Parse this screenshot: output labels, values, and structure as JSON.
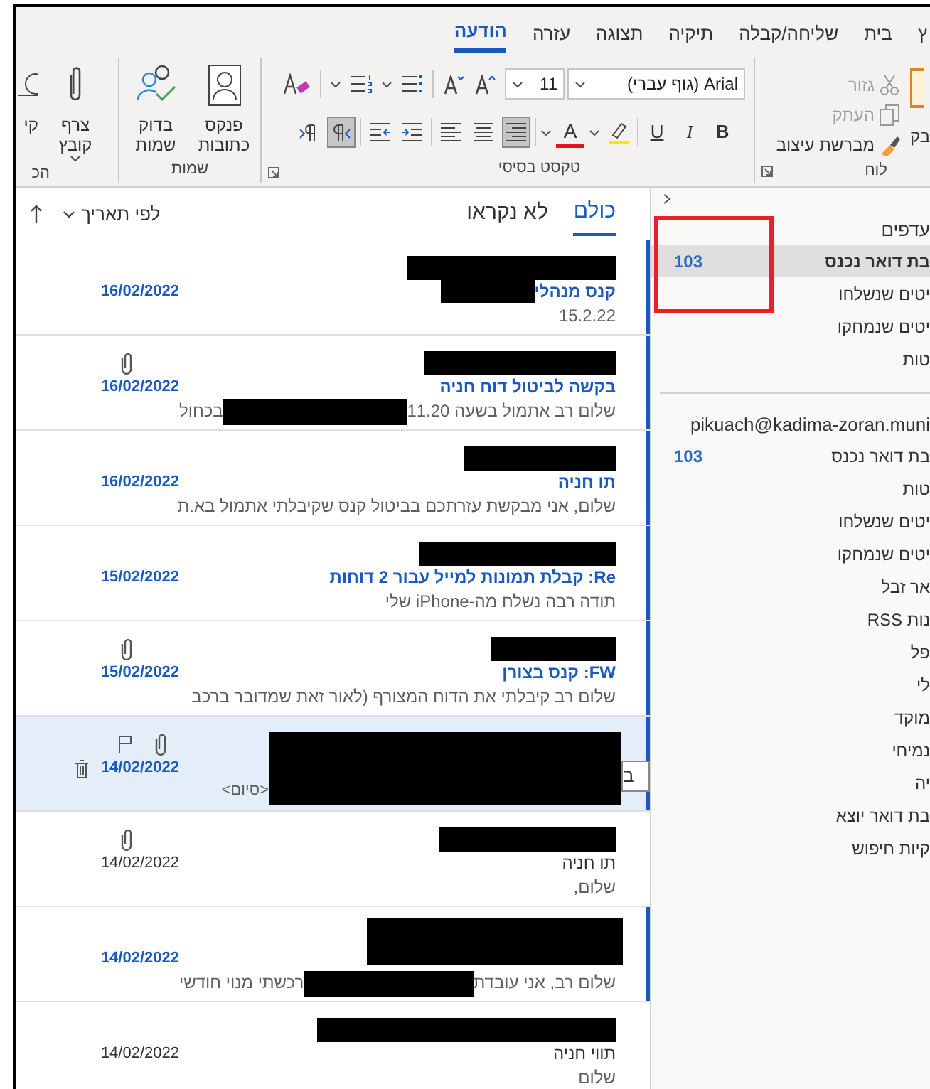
{
  "ribbon": {
    "tabs": [
      {
        "label": "ץ",
        "selected": false
      },
      {
        "label": "בית",
        "selected": false
      },
      {
        "label": "שליחה/קבלה",
        "selected": false
      },
      {
        "label": "תיקיה",
        "selected": false
      },
      {
        "label": "תצוגה",
        "selected": false
      },
      {
        "label": "עזרה",
        "selected": false
      },
      {
        "label": "הודעה",
        "selected": true
      }
    ],
    "clipboard": {
      "label": "לוח",
      "paste": "בק",
      "items": [
        {
          "kind": "cut",
          "label": "גזור",
          "disabled": true
        },
        {
          "kind": "copy",
          "label": "העתק",
          "disabled": true
        },
        {
          "kind": "painter",
          "label": "מברשת עיצוב",
          "disabled": false
        }
      ]
    },
    "basic_text": {
      "label": "טקסט בסיסי",
      "font": "Arial (גוף עברי)",
      "size": "11",
      "format_buttons": [
        {
          "kind": "bold",
          "label": "B",
          "selected": false
        },
        {
          "kind": "italic",
          "label": "I",
          "selected": false
        },
        {
          "kind": "underline",
          "label": "U",
          "selected": false
        },
        {
          "kind": "highlight",
          "selected": false
        },
        {
          "kind": "font-color",
          "label": "A",
          "selected": false
        },
        {
          "kind": "align-right",
          "selected": true
        },
        {
          "kind": "align-center",
          "selected": false
        },
        {
          "kind": "align-left",
          "selected": false
        },
        {
          "kind": "indent",
          "selected": false
        },
        {
          "kind": "outdent",
          "selected": false
        },
        {
          "kind": "rtl",
          "selected": true
        },
        {
          "kind": "ltr",
          "selected": false
        }
      ]
    },
    "names": {
      "label": "שמות",
      "buttons": [
        "פנקס כתובות",
        "בדוק שמות"
      ]
    },
    "include": {
      "label": "הכ",
      "buttons": [
        "צרף קובץ",
        "קי"
      ]
    }
  },
  "message_list": {
    "tabs": [
      {
        "label": "כולם",
        "selected": true
      },
      {
        "label": "לא נקראו",
        "selected": false
      }
    ],
    "sort": "לפי תאריך",
    "messages": [
      {
        "unread": true,
        "selected": false,
        "kind": "plain",
        "subject": "קנס מנהלי",
        "subject_redacted": true,
        "preview": "15.2.22",
        "date": "16/02/2022",
        "attachment": false,
        "flag": false
      },
      {
        "unread": true,
        "selected": false,
        "kind": "plain",
        "subject": "בקשה לביטול דוח חניה",
        "subject_redacted": false,
        "preview": "שלום רב  אתמול בשעה 11.20",
        "preview_tail": "בכחול",
        "date": "16/02/2022",
        "attachment": true,
        "flag": false
      },
      {
        "unread": true,
        "selected": false,
        "kind": "plain",
        "subject": "תו חניה",
        "subject_redacted": false,
        "preview": "שלום,  אני מבקשת עזרתכם בביטול קנס שקיבלתי אתמול בא.ת",
        "date": "16/02/2022",
        "attachment": false,
        "flag": false
      },
      {
        "unread": true,
        "selected": false,
        "kind": "plain",
        "subject": "Re: קבלת תמונות למייל עבור 2 דוחות",
        "subject_redacted": false,
        "preview": "תודה רבה  נשלח מה-iPhone שלי",
        "date": "15/02/2022",
        "attachment": false,
        "flag": false
      },
      {
        "unread": true,
        "selected": false,
        "kind": "plain",
        "subject": "FW: קנס בצורן",
        "subject_redacted": false,
        "preview": "שלום רב  קיבלתי את הדוח המצורף (לאור זאת שמדובר ברכב",
        "date": "15/02/2022",
        "attachment": true,
        "flag": false
      },
      {
        "unread": true,
        "selected": true,
        "kind": "covered",
        "preview": "<סיום>",
        "tooltip": "ב",
        "date": "14/02/2022",
        "attachment": true,
        "flag": true
      },
      {
        "unread": false,
        "selected": false,
        "kind": "plain",
        "subject": "תו חניה",
        "subject_redacted": false,
        "preview": "שלום,",
        "date": "14/02/2022",
        "attachment": true,
        "flag": false
      },
      {
        "unread": true,
        "selected": false,
        "kind": "tall",
        "preview": "שלום רב,  אני עובדת",
        "preview_tail": "רכשתי מנוי חודשי",
        "date": "14/02/2022",
        "attachment": false,
        "flag": false
      },
      {
        "unread": false,
        "selected": false,
        "kind": "plain",
        "subject": "תווי חניה",
        "subject_redacted": false,
        "preview": "שלום",
        "date": "14/02/2022",
        "attachment": false,
        "flag": false
      }
    ]
  },
  "folders": {
    "favorites": {
      "title": "עדפים",
      "highlight_box": true,
      "items": [
        {
          "label": "בת דואר נכנס",
          "count": "103",
          "selected": true
        },
        {
          "label": "יטים שנשלחו",
          "selected": false
        },
        {
          "label": "יטים שנמחקו",
          "selected": false
        },
        {
          "label": "טות",
          "selected": false
        }
      ]
    },
    "account": {
      "title": "pikuach@kadima-zoran.muni",
      "items": [
        {
          "label": "בת דואר נכנס",
          "count": "103",
          "selected": false
        },
        {
          "label": "טות",
          "selected": false
        },
        {
          "label": "יטים שנשלחו",
          "selected": false
        },
        {
          "label": "יטים שנמחקו",
          "selected": false
        },
        {
          "label": "אר זבל",
          "selected": false
        },
        {
          "label": "נות RSS",
          "selected": false
        },
        {
          "label": "פל",
          "selected": false
        },
        {
          "label": "לי",
          "selected": false
        },
        {
          "label": "מוקד",
          "selected": false
        },
        {
          "label": "נמיחי",
          "selected": false
        },
        {
          "label": "יה",
          "selected": false
        },
        {
          "label": "בת דואר יוצא",
          "selected": false
        },
        {
          "label": "קיות חיפוש",
          "selected": false
        }
      ]
    }
  }
}
